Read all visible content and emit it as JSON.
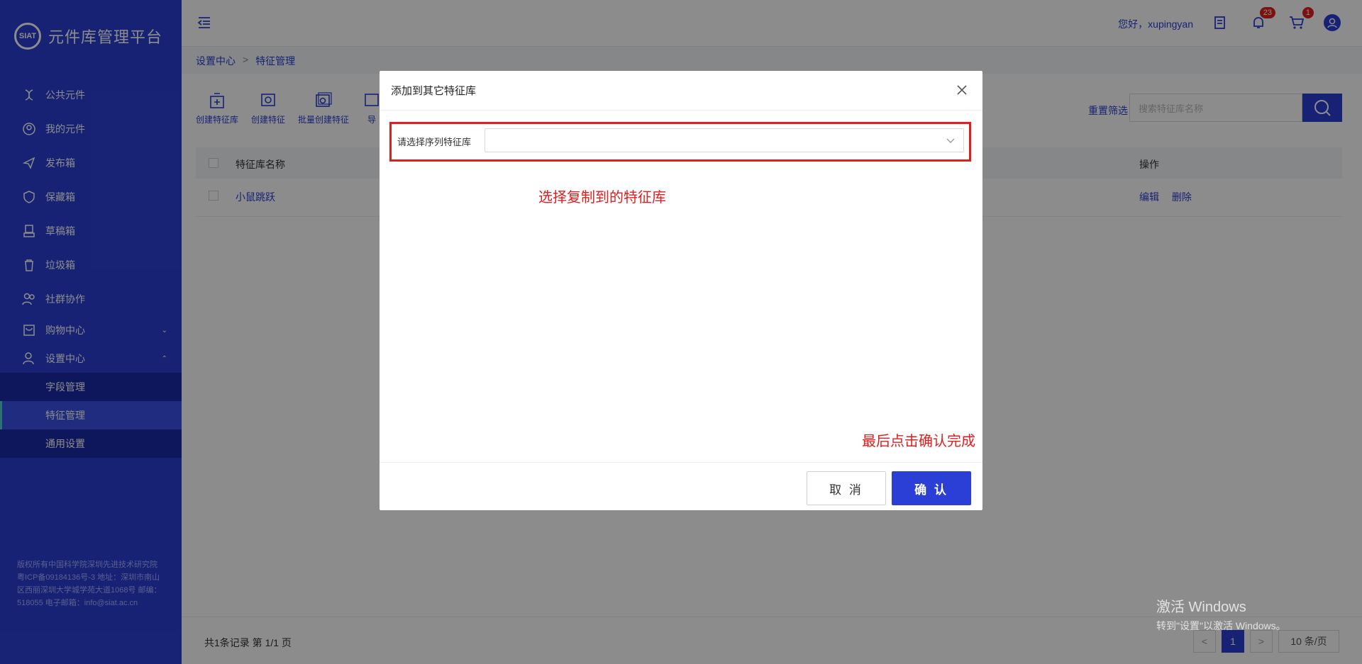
{
  "app": {
    "title": "元件库管理平台"
  },
  "sidebar": {
    "items": [
      {
        "label": "公共元件",
        "icon": "dna-icon"
      },
      {
        "label": "我的元件",
        "icon": "user-circle-icon"
      },
      {
        "label": "发布箱",
        "icon": "send-icon"
      },
      {
        "label": "保藏箱",
        "icon": "shield-icon"
      },
      {
        "label": "草稿箱",
        "icon": "draft-icon"
      },
      {
        "label": "垃圾箱",
        "icon": "trash-icon"
      },
      {
        "label": "社群协作",
        "icon": "users-icon"
      },
      {
        "label": "购物中心",
        "icon": "shop-icon"
      },
      {
        "label": "设置中心",
        "icon": "user-settings-icon"
      }
    ],
    "submenu": [
      {
        "label": "字段管理"
      },
      {
        "label": "特征管理"
      },
      {
        "label": "通用设置"
      }
    ],
    "copyright": "版权所有中国科学院深圳先进技术研究院 粤ICP备09184136号-3 地址：深圳市南山区西丽深圳大学城学苑大道1068号 邮编：518055 电子邮箱：info@siat.ac.cn"
  },
  "header": {
    "greeting": "您好，xupingyan",
    "notification_count": "23",
    "cart_count": "1"
  },
  "breadcrumb": {
    "parent": "设置中心",
    "separator": ">",
    "current": "特征管理"
  },
  "toolbar": {
    "items": [
      "创建特征库",
      "创建特征",
      "批量创建特征",
      "导"
    ],
    "reset_filter": "重置筛选",
    "search_placeholder": "搜索特征库名称"
  },
  "table": {
    "headers": {
      "name": "特征库名称",
      "ops": "操作"
    },
    "rows": [
      {
        "name": "小鼠跳跃",
        "edit": "编辑",
        "delete": "删除"
      }
    ]
  },
  "pagination": {
    "summary": "共1条记录 第 1/1 页",
    "prev": "<",
    "current_page": "1",
    "next": ">",
    "page_size": "10 条/页"
  },
  "modal": {
    "title": "添加到其它特征库",
    "select_label": "请选择序列特征库",
    "annotation_select": "选择复制到的特征库",
    "annotation_confirm": "最后点击确认完成",
    "cancel_label": "取 消",
    "ok_label": "确 认"
  },
  "watermark": {
    "title": "激活 Windows",
    "subtitle": "转到\"设置\"以激活 Windows。"
  },
  "colors": {
    "primary": "#2b3fd6",
    "annotation": "#e01e1e"
  }
}
